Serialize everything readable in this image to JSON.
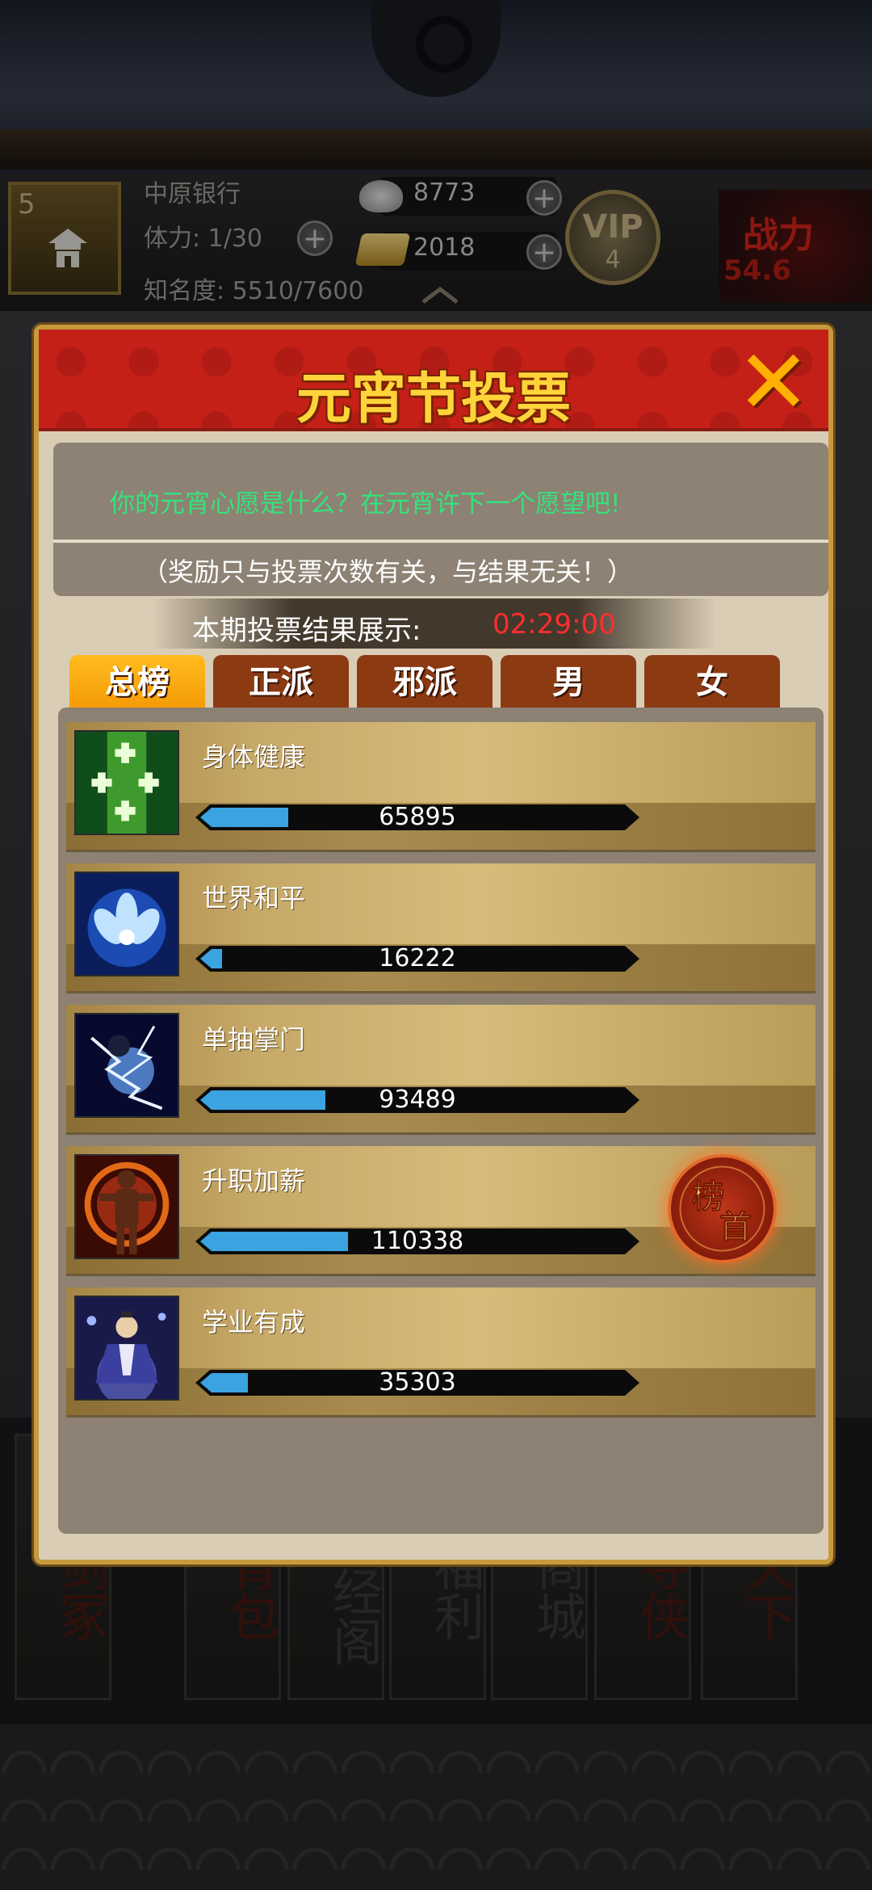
{
  "status": {
    "level": "5",
    "bank_name": "中原银行",
    "stamina": "体力: 1/30",
    "fame": "知名度: 5510/7600",
    "silver": "8773",
    "gold": "2018",
    "vip_label": "VIP",
    "vip_level": "4",
    "power_label": "战力",
    "power_value": "54.6"
  },
  "popup": {
    "title": "元宵节投票",
    "wish_text": "你的元宵心愿是什么？在元宵许下一个愿望吧!",
    "note_text": "（奖励只与投票次数有关，与结果无关！）",
    "countdown_label": "本期投票结果展示:",
    "countdown_time": "02:29:00",
    "tabs": [
      {
        "label": "总榜",
        "active": true
      },
      {
        "label": "正派",
        "active": false
      },
      {
        "label": "邪派",
        "active": false
      },
      {
        "label": "男",
        "active": false
      },
      {
        "label": "女",
        "active": false
      }
    ],
    "items": [
      {
        "name": "身体健康",
        "votes": "65895",
        "fraction": 0.597,
        "icon": "health-icon"
      },
      {
        "name": "世界和平",
        "votes": "16222",
        "fraction": 0.147,
        "icon": "peace-icon"
      },
      {
        "name": "单抽掌门",
        "votes": "93489",
        "fraction": 0.847,
        "icon": "lightning-icon"
      },
      {
        "name": "升职加薪",
        "votes": "110338",
        "fraction": 1.0,
        "icon": "promotion-icon",
        "top": true
      },
      {
        "name": "学业有成",
        "votes": "35303",
        "fraction": 0.32,
        "icon": "study-icon"
      }
    ],
    "top_seal_text": "榜首"
  },
  "bottom_nav": [
    {
      "label": "剑冢"
    },
    {
      "label": "背包"
    },
    {
      "label": "藏经阁"
    },
    {
      "label": "福利"
    },
    {
      "label": "商城"
    },
    {
      "label": "寻侠"
    },
    {
      "label": "天下"
    }
  ],
  "colors": {
    "accent_gold": "#ffd43a",
    "header_red": "#c42018",
    "tab_active": "#f5a30e",
    "tab_inactive": "#8b3a12",
    "bar_fill": "#3aa3e0",
    "wish_green": "#36e27a",
    "countdown_red": "#ff2e2e"
  }
}
